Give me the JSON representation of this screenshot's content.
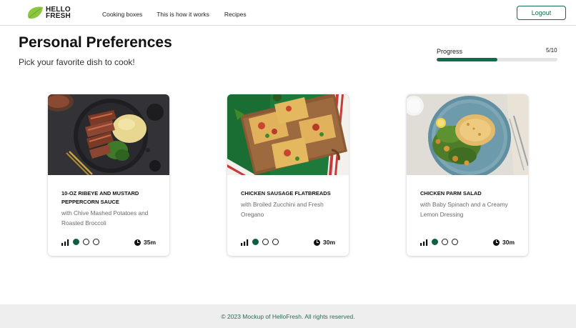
{
  "header": {
    "logo_line1": "HELLO",
    "logo_line2": "FRESH",
    "nav": [
      "Cooking boxes",
      "This is how it works",
      "Recipes"
    ],
    "logout_label": "Logout"
  },
  "page": {
    "title": "Personal Preferences",
    "subtitle": "Pick your favorite dish to cook!"
  },
  "progress": {
    "label": "Progress",
    "count": "5/10",
    "fraction": 0.5
  },
  "cards": [
    {
      "name": "10-OZ RIBEYE AND MUSTARD PEPPERCORN SAUCE",
      "description": "with Chive Mashed Potatoes and Roasted Broccoli",
      "difficulty_level": 1,
      "difficulty_max": 3,
      "time": "35m",
      "image_icon": "steak-dish-photo"
    },
    {
      "name": "CHICKEN SAUSAGE FLATBREADS",
      "description": "with Broiled Zucchini and Fresh Oregano",
      "difficulty_level": 1,
      "difficulty_max": 3,
      "time": "30m",
      "image_icon": "flatbread-dish-photo"
    },
    {
      "name": "CHICKEN PARM SALAD",
      "description": "with Baby Spinach and a Creamy Lemon Dressing",
      "difficulty_level": 1,
      "difficulty_max": 3,
      "time": "30m",
      "image_icon": "salad-dish-photo"
    }
  ],
  "footer": {
    "text": "© 2023 Mockup of HelloFresh. All rights reserved."
  },
  "colors": {
    "brand_green": "#0f6b4b",
    "logo_lime": "#8cc63f",
    "footer_bg": "#eeeeee"
  }
}
